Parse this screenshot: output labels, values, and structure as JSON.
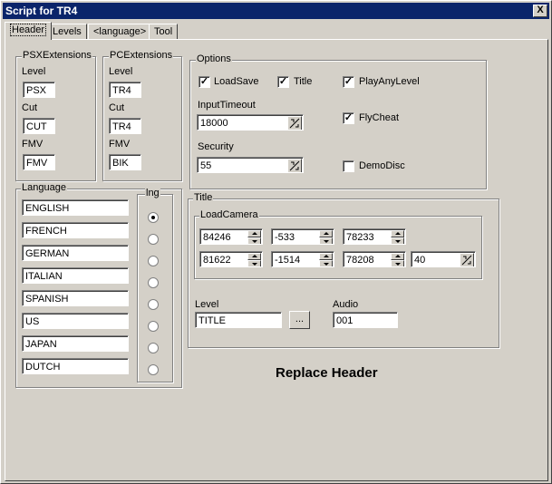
{
  "window": {
    "title": "Script for TR4",
    "close_label": "X"
  },
  "tabs": [
    "Header",
    "Levels",
    "<language>",
    "Tool"
  ],
  "psx": {
    "legend": "PSXExtensions",
    "level_label": "Level",
    "level_value": "PSX",
    "cut_label": "Cut",
    "cut_value": "CUT",
    "fmv_label": "FMV",
    "fmv_value": "FMV"
  },
  "pc": {
    "legend": "PCExtensions",
    "level_label": "Level",
    "level_value": "TR4",
    "cut_label": "Cut",
    "cut_value": "TR4",
    "fmv_label": "FMV",
    "fmv_value": "BIK"
  },
  "options": {
    "legend": "Options",
    "loadsave": "LoadSave",
    "title": "Title",
    "playanylevel": "PlayAnyLevel",
    "flycheat": "FlyCheat",
    "demodisc": "DemoDisc",
    "inputtimeout_label": "InputTimeout",
    "inputtimeout_value": "18000",
    "security_label": "Security",
    "security_value": "55"
  },
  "language": {
    "legend": "Language",
    "lng_label": "lng",
    "items": [
      "ENGLISH",
      "FRENCH",
      "GERMAN",
      "ITALIAN",
      "SPANISH",
      "US",
      "JAPAN",
      "DUTCH"
    ]
  },
  "title_section": {
    "legend": "Title",
    "loadcamera_legend": "LoadCamera",
    "cam": [
      "84246",
      "-533",
      "78233",
      "81622",
      "-1514",
      "78208",
      "40"
    ],
    "level_label": "Level",
    "level_value": "TITLE",
    "browse_label": "...",
    "audio_label": "Audio",
    "audio_value": "001"
  },
  "replace_header": "Replace Header"
}
